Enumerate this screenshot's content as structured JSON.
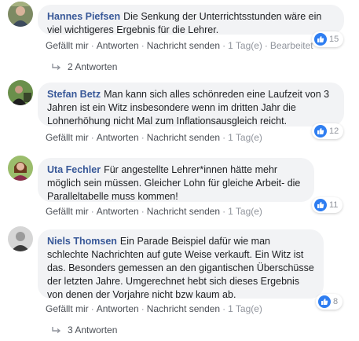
{
  "comments": [
    {
      "author": "Hannes Piefsen",
      "text": "Die Senkung der Unterrichtsstunden wäre ein viel wichtigeres Ergebnis für die Lehrer.",
      "likes": "15",
      "actions": {
        "like": "Gefällt mir",
        "reply": "Antworten",
        "message": "Nachricht senden",
        "time": "1 Tag(e)",
        "edit": "Bearbeitet"
      },
      "replies": "2 Antworten"
    },
    {
      "author": "Stefan Betz",
      "text": "Man kann sich alles schönreden eine Laufzeit von 3 Jahren ist ein Witz insbesondere wenn im dritten Jahr die Lohnerhöhung nicht Mal zum Inflationsausgleich reicht.",
      "likes": "12",
      "actions": {
        "like": "Gefällt mir",
        "reply": "Antworten",
        "message": "Nachricht senden",
        "time": "1 Tag(e)"
      }
    },
    {
      "author": "Uta Fechler",
      "text": "Für angestellte Lehrer*innen hätte mehr möglich sein müssen. Gleicher Lohn für gleiche Arbeit- die Paralleltabelle muss kommen!",
      "likes": "11",
      "actions": {
        "like": "Gefällt mir",
        "reply": "Antworten",
        "message": "Nachricht senden",
        "time": "1 Tag(e)"
      }
    },
    {
      "author": "Niels Thomsen",
      "text": "Ein Parade Beispiel dafür wie man schlechte Nachrichten auf gute Weise verkauft. Ein Witz ist das. Besonders gemessen an den gigantischen Überschüsse der letzten Jahre. Umgerechnet hebt sich dieses Ergebnis von denen der Vorjahre nicht bzw kaum ab.",
      "likes": "8",
      "actions": {
        "like": "Gefällt mir",
        "reply": "Antworten",
        "message": "Nachricht senden",
        "time": "1 Tag(e)"
      },
      "replies": "3 Antworten"
    }
  ],
  "colors": {
    "author": "#385898",
    "bubble": "#f2f3f5",
    "like": "#2f7ef1",
    "meta": "#90949c"
  }
}
